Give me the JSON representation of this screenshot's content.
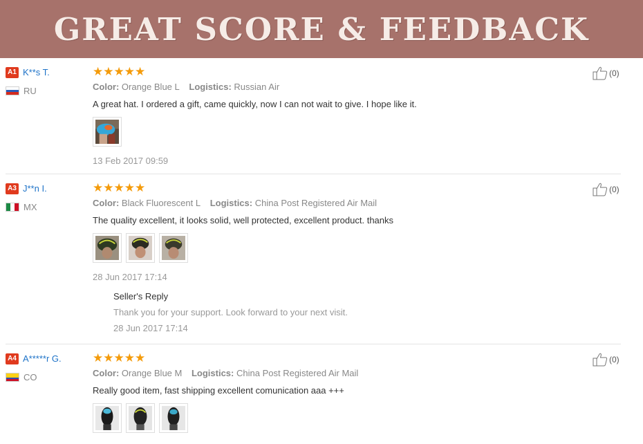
{
  "banner": {
    "title": "GREAT SCORE & FEEDBACK"
  },
  "labels": {
    "color": "Color:",
    "logistics": "Logistics:"
  },
  "reviews": [
    {
      "level": "A1",
      "user": "K**s T.",
      "country": "RU",
      "rating": "★★★★★",
      "color_value": "Orange Blue L",
      "logistics_value": "Russian Air",
      "text": "A great hat. I ordered a gift, came quickly, now I can not wait to give. I hope like it.",
      "date": "13 Feb 2017 09:59",
      "helpful": "(0)"
    },
    {
      "level": "A3",
      "user": "J**n I.",
      "country": "MX",
      "rating": "★★★★★",
      "color_value": "Black Fluorescent L",
      "logistics_value": "China Post Registered Air Mail",
      "text": "The quality excellent, it looks solid, well protected, excellent product. thanks",
      "date": "28 Jun 2017 17:14",
      "helpful": "(0)",
      "seller_reply": {
        "title": "Seller's Reply",
        "text": "Thank you for your support. Look forward to your next visit.",
        "date": "28 Jun 2017 17:14"
      }
    },
    {
      "level": "A4",
      "user": "A*****r G.",
      "country": "CO",
      "rating": "★★★★★",
      "color_value": "Orange Blue M",
      "logistics_value": "China Post Registered Air Mail",
      "text": "Really good item, fast shipping excellent comunication aaa +++",
      "helpful": "(0)"
    }
  ],
  "colors": {
    "banner": "#a7726b",
    "link": "#1e73c8",
    "star": "#f49b0b",
    "badge": "#e03a1e"
  }
}
